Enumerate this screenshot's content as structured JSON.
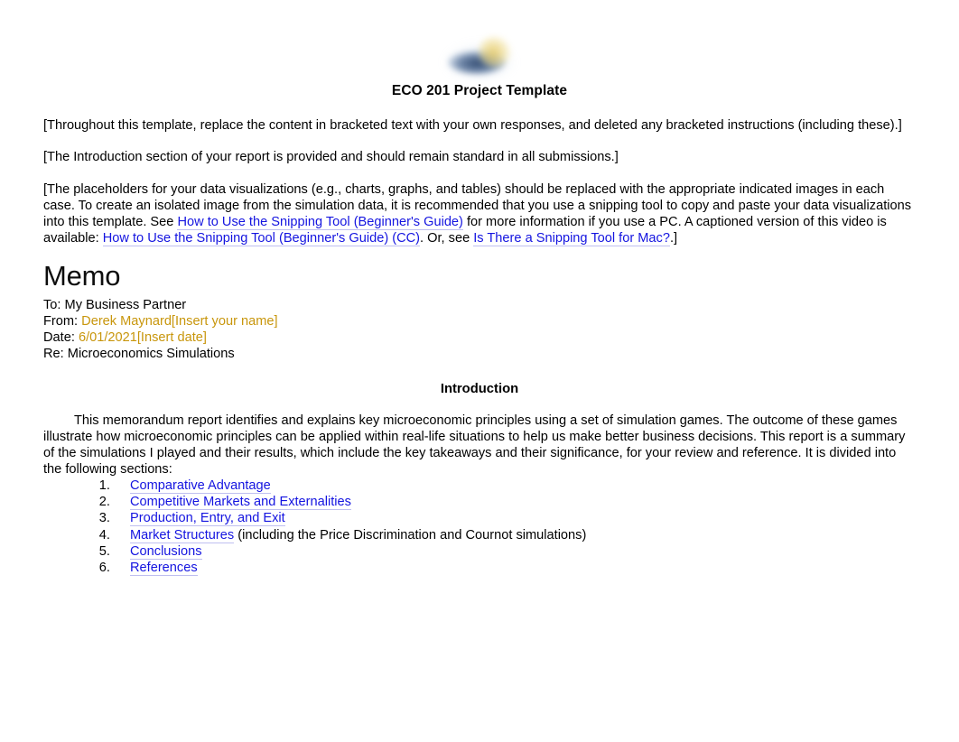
{
  "document": {
    "title": "ECO 201 Project Template",
    "logo_alt": "course-logo",
    "instructions": {
      "p1": "[Throughout this template, replace the content in bracketed text with your own responses, and deleted any bracketed instructions (including these).]",
      "p2": "[The Introduction section of your report is provided and should remain standard in all submissions.]",
      "p3_part1": "[The placeholders for your data visualizations (e.g., charts, graphs, and tables) should be replaced with the appropriate indicated images in each case. To create an isolated image from the simulation data, it is recommended that you use a snipping tool to copy and paste your data visualizations into this template. See ",
      "p3_link1": "How to Use the Snipping Tool (Beginner's Guide)",
      "p3_part2": " for more information if you use a PC. A captioned version of this video is available: ",
      "p3_link2": "How to Use the Snipping Tool (Beginner's Guide) (CC)",
      "p3_part3": ". Or, see ",
      "p3_link3": "Is There a Snipping Tool for Mac?",
      "p3_part4": ".]"
    },
    "memo": {
      "heading": "Memo",
      "to_label": "To:",
      "to_value": "My Business Partner",
      "from_label": "From:",
      "from_value": "Derek Maynard[Insert your name]",
      "date_label": "Date:",
      "date_value": "6/01/2021[Insert date]",
      "re_label": "Re:",
      "re_value": "Microeconomics Simulations"
    },
    "introduction": {
      "heading": "Introduction",
      "body": "This memorandum report identifies and explains key microeconomic principles using a set of simulation games. The outcome of these games illustrate how microeconomic principles can be applied within real-life situations to help us make better business decisions. This report is a summary of the simulations I played and their results, which include the key takeaways and their significance, for your review and reference. It is divided into the following sections:"
    },
    "toc": [
      {
        "label": "Comparative Advantage",
        "note": ""
      },
      {
        "label": "Competitive Markets and Externalities",
        "note": ""
      },
      {
        "label": "Production, Entry, and Exit",
        "note": ""
      },
      {
        "label": "Market Structures",
        "note": " (including the Price Discrimination and Cournot simulations)"
      },
      {
        "label": "Conclusions",
        "note": ""
      },
      {
        "label": "References",
        "note": ""
      }
    ],
    "colors": {
      "link_blue": "#1414E0",
      "highlight_gold": "#C8960C",
      "text_black": "#000000"
    }
  }
}
